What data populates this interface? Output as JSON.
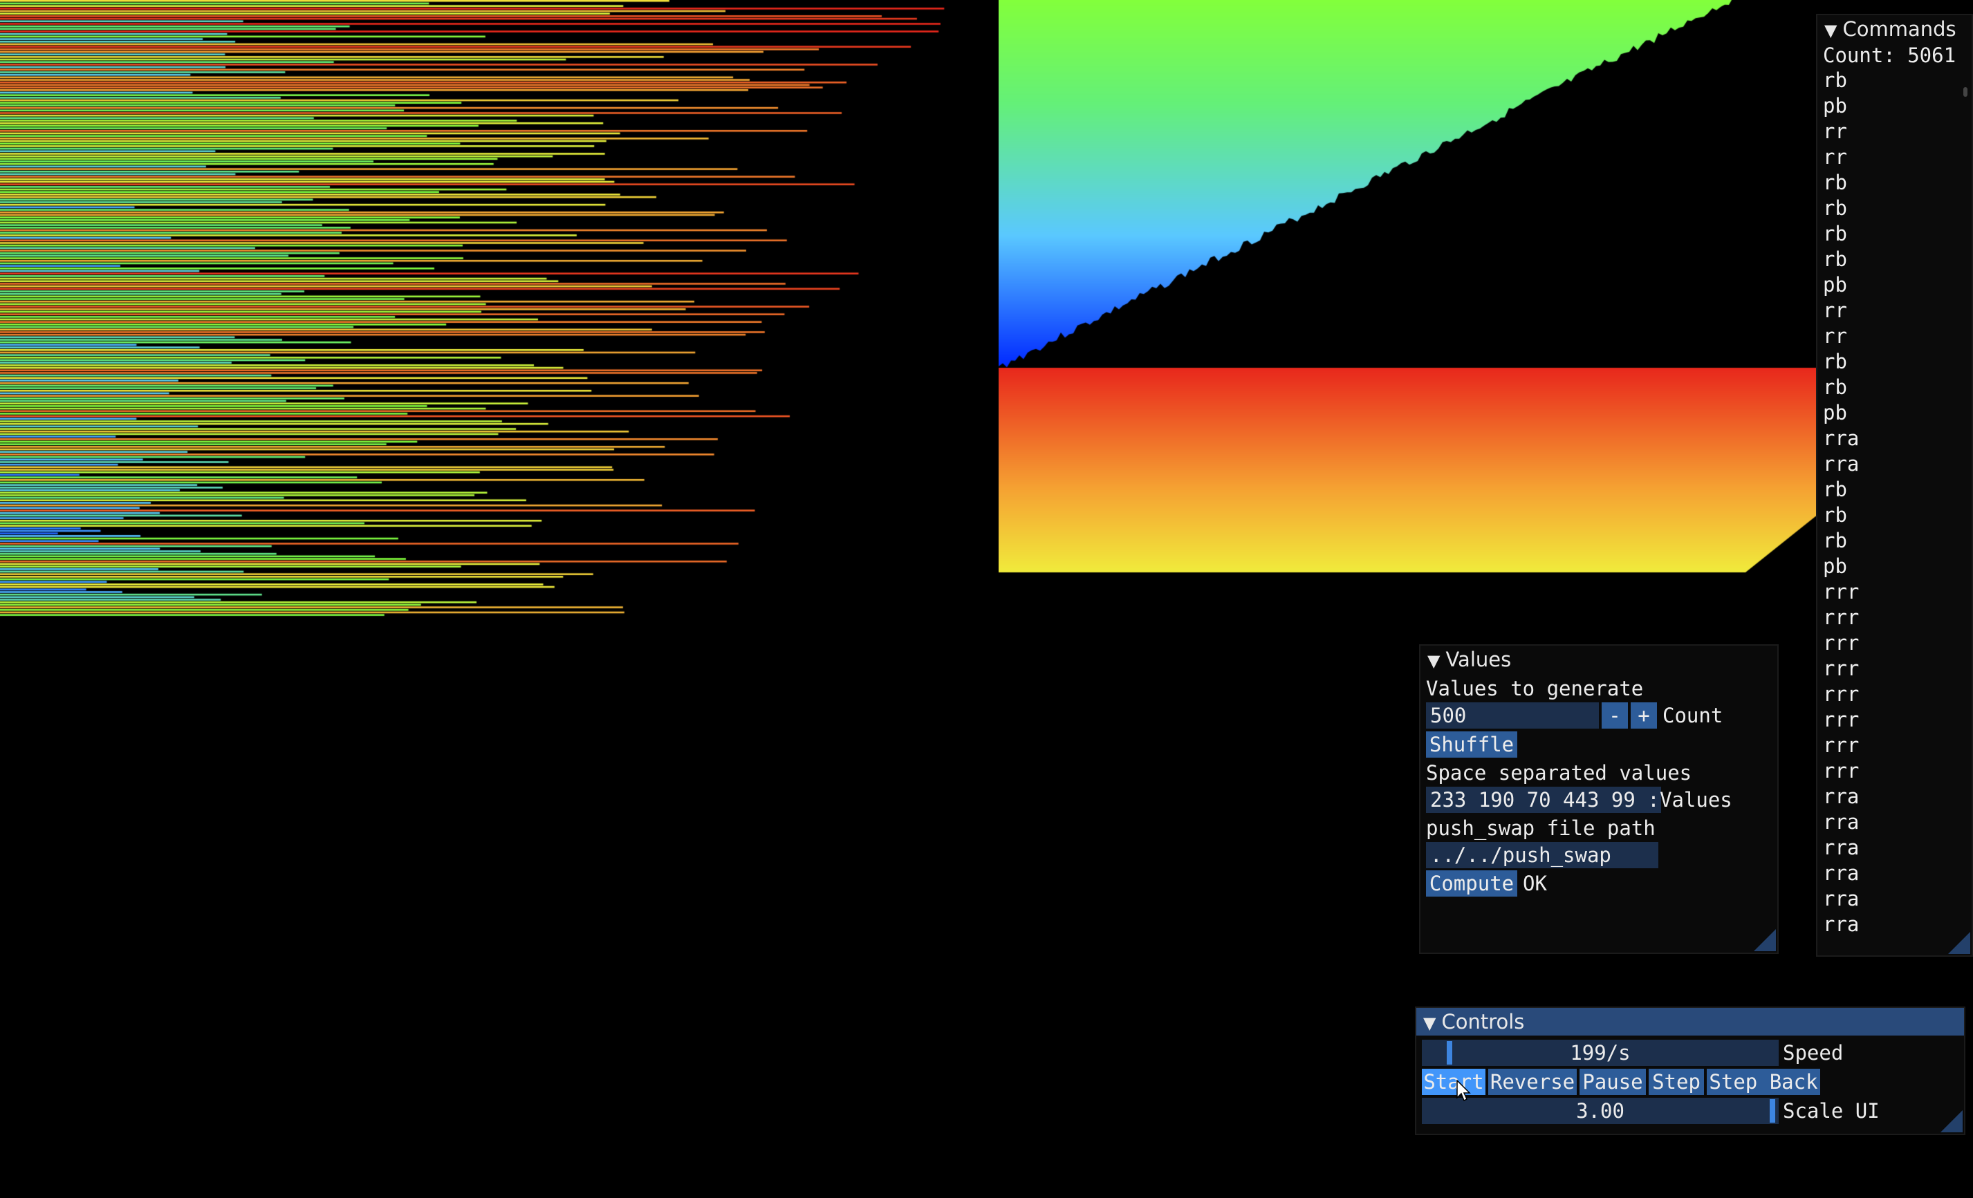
{
  "commands_panel": {
    "title": "Commands",
    "count_label": "Count: 5061",
    "items": [
      "rb",
      "pb",
      "rr",
      "rr",
      "rb",
      "rb",
      "rb",
      "rb",
      "pb",
      "rr",
      "rr",
      "rb",
      "rb",
      "pb",
      "rra",
      "rra",
      "rb",
      "rb",
      "rb",
      "pb",
      "rrr",
      "rrr",
      "rrr",
      "rrr",
      "rrr",
      "rrr",
      "rrr",
      "rrr",
      "rra",
      "rra",
      "rra",
      "rra",
      "rra",
      "rra"
    ]
  },
  "values_panel": {
    "title": "Values",
    "generate_label": "Values to generate",
    "count_value": "500",
    "minus_label": "-",
    "plus_label": "+",
    "count_label": "Count",
    "shuffle_label": "Shuffle",
    "space_label": "Space separated values",
    "values_input": "233 190 70 443 99 :",
    "values_label": "Values",
    "path_label": "push_swap file path",
    "path_input": "../../push_swap",
    "compute_label": "Compute",
    "status": "OK"
  },
  "controls_panel": {
    "title": "Controls",
    "speed_value": "199/s",
    "speed_fraction": 0.07,
    "speed_label": "Speed",
    "buttons": [
      "Start",
      "Reverse",
      "Pause",
      "Step",
      "Step Back"
    ],
    "scale_value": "3.00",
    "scale_fraction": 0.99,
    "scale_label": "Scale UI"
  },
  "visualization": {
    "stack_a_count": 242,
    "stack_b_count": 258,
    "colors": {
      "low": "#0030ff",
      "mid_low": "#60d8ff",
      "mid": "#80ff40",
      "mid_high": "#ffff40",
      "high": "#e8281c"
    }
  }
}
